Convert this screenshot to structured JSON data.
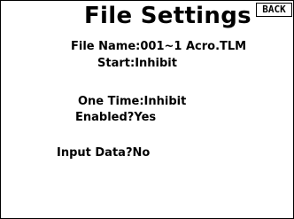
{
  "header": {
    "title": "File Settings",
    "back_label": "BACK"
  },
  "settings": {
    "file_name": {
      "label": "File Name:",
      "value": "001~1 Acro.TLM"
    },
    "start": {
      "label": "Start:",
      "value": "Inhibit"
    },
    "one_time": {
      "label": "One Time:",
      "value": "Inhibit"
    },
    "enabled": {
      "label": "Enabled?",
      "value": "Yes"
    },
    "input_data": {
      "label": "Input Data?",
      "value": "No"
    }
  }
}
